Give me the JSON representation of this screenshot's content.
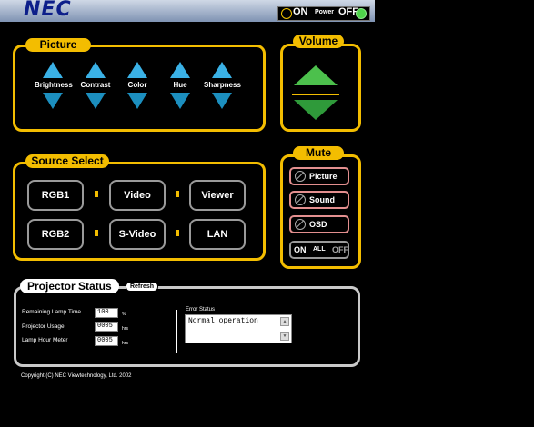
{
  "header": {
    "logo": "NEC",
    "power": {
      "on_label": "ON",
      "power_label": "Power",
      "off_label": "OFF"
    }
  },
  "picture": {
    "title": "Picture",
    "controls": [
      "Brightness",
      "Contrast",
      "Color",
      "Hue",
      "Sharpness"
    ]
  },
  "volume": {
    "title": "Volume"
  },
  "source": {
    "title": "Source Select",
    "row1": [
      "RGB1",
      "Video",
      "Viewer"
    ],
    "row2": [
      "RGB2",
      "S-Video",
      "LAN"
    ]
  },
  "mute": {
    "title": "Mute",
    "buttons": [
      "Picture",
      "Sound",
      "OSD"
    ],
    "all": {
      "on": "ON",
      "all": "ALL",
      "off": "OFF"
    }
  },
  "status": {
    "title": "Projector Status",
    "refresh": "Refresh",
    "rows": [
      {
        "label": "Remaining Lamp Time",
        "value": "100",
        "unit": "%"
      },
      {
        "label": "Projector Usage",
        "value": "0005",
        "unit": "hrs"
      },
      {
        "label": "Lamp Hour Meter",
        "value": "0005",
        "unit": "hrs"
      }
    ],
    "error_label": "Error Status",
    "error_text": "Normal operation"
  },
  "footer": {
    "copyright": "Copyright (C) NEC Viewtechnology, Ltd. 2002"
  },
  "colors": {
    "accent": "#f3bd00",
    "arrow_blue": "#3ab1e6",
    "vol_green": "#4cc04c",
    "mute_pink": "#e38f8f"
  }
}
